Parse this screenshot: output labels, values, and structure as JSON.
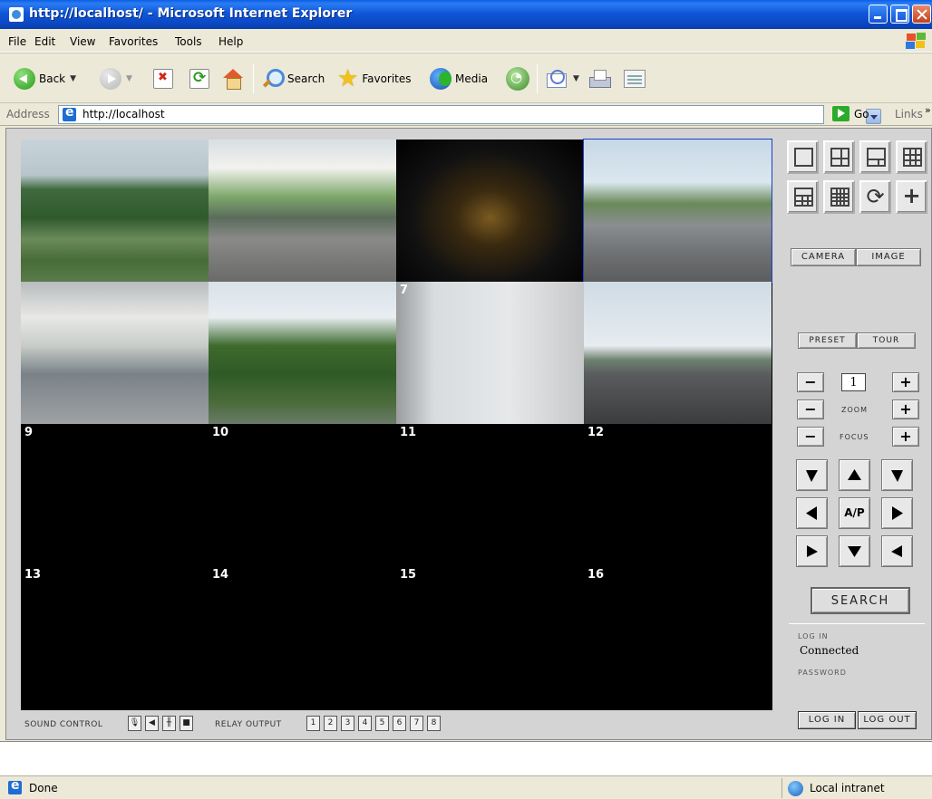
{
  "window": {
    "title": "http://localhost/ - Microsoft Internet Explorer"
  },
  "menu": {
    "items": [
      "File",
      "Edit",
      "View",
      "Favorites",
      "Tools",
      "Help"
    ]
  },
  "toolbar": {
    "back_label": "Back",
    "search_label": "Search",
    "favorites_label": "Favorites",
    "media_label": "Media"
  },
  "address": {
    "label": "Address",
    "url": "http://localhost",
    "go_label": "Go",
    "links_label": "Links"
  },
  "video_grid": {
    "cells": [
      {
        "num": "",
        "scene": "hillside-resort"
      },
      {
        "num": "",
        "scene": "gas-station-car"
      },
      {
        "num": "",
        "scene": "night-lights"
      },
      {
        "num": "",
        "scene": "street-truck"
      },
      {
        "num": "",
        "scene": "shell-station"
      },
      {
        "num": "",
        "scene": "hotel-palms"
      },
      {
        "num": "7",
        "scene": "room-wall"
      },
      {
        "num": "",
        "scene": "bridge"
      },
      {
        "num": "9",
        "scene": "no-signal"
      },
      {
        "num": "10",
        "scene": "no-signal"
      },
      {
        "num": "11",
        "scene": "no-signal"
      },
      {
        "num": "12",
        "scene": "no-signal"
      },
      {
        "num": "13",
        "scene": "no-signal"
      },
      {
        "num": "14",
        "scene": "no-signal"
      },
      {
        "num": "15",
        "scene": "no-signal"
      },
      {
        "num": "16",
        "scene": "no-signal"
      }
    ]
  },
  "bottom": {
    "sound_label": "SOUND CONTROL",
    "relay_label": "RELAY OUTPUT",
    "relay_buttons": [
      "1",
      "2",
      "3",
      "4",
      "5",
      "6",
      "7",
      "8"
    ]
  },
  "panel": {
    "camera_label": "CAMERA",
    "image_label": "IMAGE",
    "preset_label": "PRESET",
    "tour_label": "TOUR",
    "preset_value": "1",
    "zoom_label": "ZOOM",
    "focus_label": "FOCUS",
    "ap_label": "A/P",
    "search_label": "SEARCH",
    "login_caption": "LOG IN",
    "login_value": "Connected",
    "password_caption": "PASSWORD",
    "login_button": "LOG IN",
    "logout_button": "LOG OUT"
  },
  "status": {
    "text": "Done",
    "zone": "Local intranet"
  }
}
